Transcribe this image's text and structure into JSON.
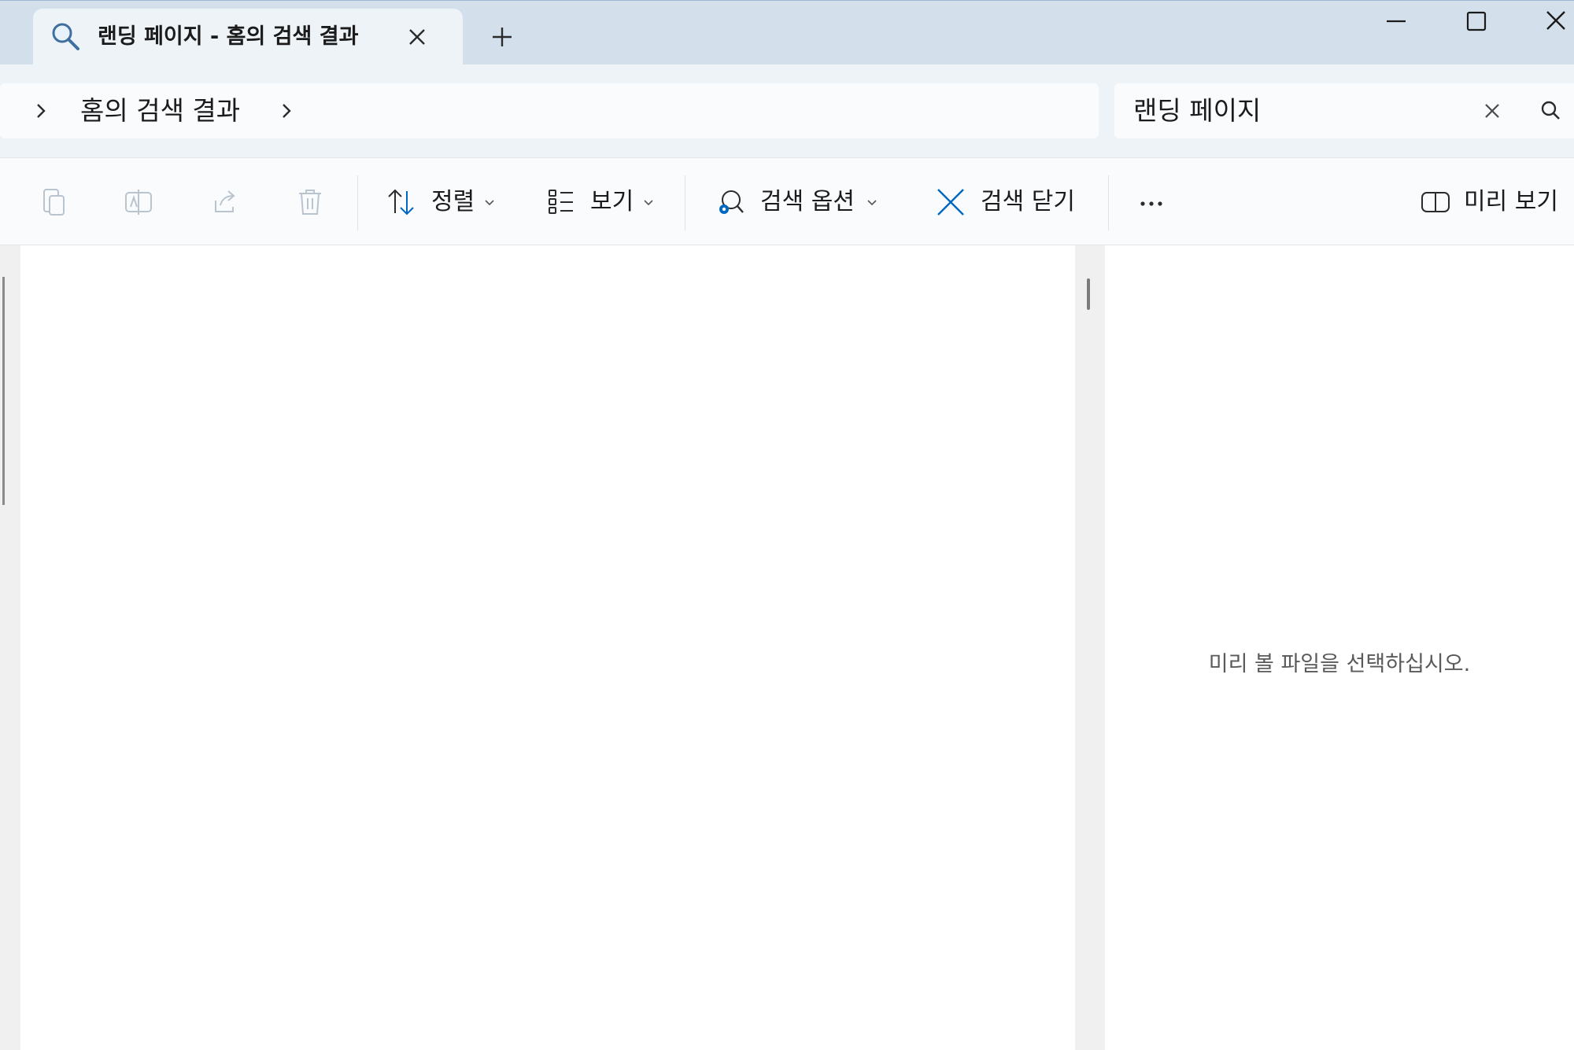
{
  "tab": {
    "title": "랜딩 페이지 - 홈의 검색 결과"
  },
  "address_bar": {
    "breadcrumb_text": "홈의 검색 결과"
  },
  "search": {
    "value": "랜딩 페이지"
  },
  "toolbar": {
    "sort_label": "정렬",
    "view_label": "보기",
    "search_options_label": "검색 옵션",
    "close_search_label": "검색 닫기",
    "preview_label": "미리 보기"
  },
  "preview_pane": {
    "message": "미리 볼 파일을 선택하십시오."
  },
  "icons": {
    "tab": "search-icon",
    "tab_close": "close-icon",
    "new_tab": "plus-icon",
    "minimize": "minimize-icon",
    "maximize": "maximize-icon",
    "close_window": "close-icon",
    "cut": "cut-icon",
    "rename": "rename-icon",
    "share": "share-icon",
    "delete": "delete-icon",
    "sort": "sort-icon",
    "view": "view-list-icon",
    "search_options": "search-options-icon",
    "close_search": "close-icon",
    "more": "more-icon",
    "preview": "preview-pane-icon"
  },
  "colors": {
    "titlebar_bg": "#d3e0ec",
    "tab_bg": "#eef3f8",
    "accent": "#0067c0"
  }
}
